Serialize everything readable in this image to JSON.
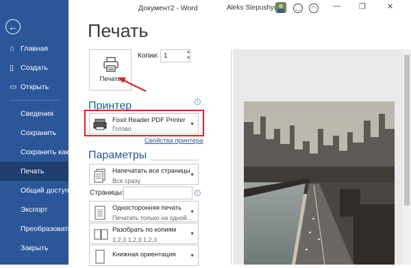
{
  "titlebar": {
    "doc_title": "Документ2 - Word",
    "user_name": "Aleks Stepushyn",
    "minimize": "—",
    "restore": "❐",
    "close": "✕"
  },
  "sidebar": {
    "back_icon": "←",
    "items": [
      {
        "label": "Главная",
        "icon": "⌂"
      },
      {
        "label": "Создать",
        "icon": "▯"
      },
      {
        "label": "Открыть",
        "icon": "▭"
      },
      {
        "label": "Сведения"
      },
      {
        "label": "Сохранить"
      },
      {
        "label": "Сохранить как"
      },
      {
        "label": "Печать"
      },
      {
        "label": "Общий доступ"
      },
      {
        "label": "Экспорт"
      },
      {
        "label": "Преобразовать"
      },
      {
        "label": "Закрыть"
      }
    ]
  },
  "main": {
    "heading": "Печать",
    "print_button": "Печать",
    "copies_label": "Копии:",
    "copies_value": "1",
    "printer_section": "Принтер",
    "printer_name": "Foxit Reader PDF Printer",
    "printer_status": "Готово",
    "printer_props_link": "Свойства принтера",
    "params_section": "Параметры",
    "settings": [
      {
        "title": "Напечатать все страницы",
        "subtitle": "Все сразу"
      },
      {
        "title": "Односторонняя печать",
        "subtitle": "Печатать только на одной..."
      },
      {
        "title": "Разобрать по копиям",
        "subtitle": "1,2,3    1,2,3    1,2,3"
      },
      {
        "title": "Книжная ориентация",
        "subtitle": ""
      }
    ],
    "pages_label": "Страницы:",
    "pages_value": ""
  },
  "colors": {
    "accent": "#2b579a",
    "highlight": "#e02020"
  }
}
